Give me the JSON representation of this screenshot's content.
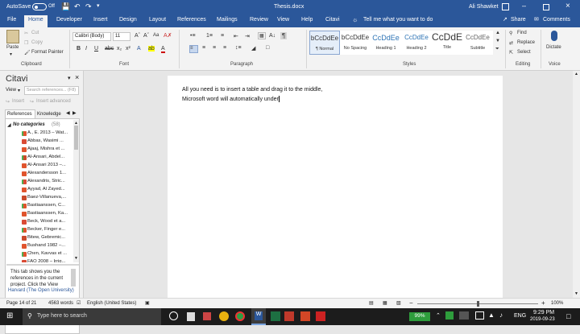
{
  "titlebar": {
    "autosave": "AutoSave",
    "autosave_state": "Off",
    "filename": "Thesis.docx",
    "user": "Ali Shawket"
  },
  "tabs": [
    "File",
    "Home",
    "Developer",
    "Insert",
    "Design",
    "Layout",
    "References",
    "Mailings",
    "Review",
    "View",
    "Help",
    "Citavi"
  ],
  "tell_me": "Tell me what you want to do",
  "share": "Share",
  "comments": "Comments",
  "clipboard": {
    "paste": "Paste",
    "cut": "Cut",
    "copy": "Copy",
    "format_painter": "Format Painter",
    "label": "Clipboard"
  },
  "font": {
    "name": "Calibri (Body)",
    "size": "11",
    "label": "Font"
  },
  "paragraph": {
    "label": "Paragraph"
  },
  "styles": {
    "label": "Styles",
    "items": [
      {
        "preview": "bCcDdEe",
        "name": "¶ Normal"
      },
      {
        "preview": "bCcDdEe",
        "name": "No Spacing"
      },
      {
        "preview": "CcDdEe",
        "name": "Heading 1"
      },
      {
        "preview": "CcDdEe",
        "name": "Heading 2"
      },
      {
        "preview": "CcDdEe",
        "name": "Title"
      },
      {
        "preview": "CcDdEe",
        "name": "Subtitle"
      }
    ]
  },
  "editing": {
    "find": "Find",
    "replace": "Replace",
    "select": "Select",
    "label": "Editing"
  },
  "voice": {
    "dictate": "Dictate",
    "label": "Voice"
  },
  "citavi": {
    "title": "Citavi",
    "view": "View",
    "search_placeholder": "Search references... (F8)",
    "insert": "Insert",
    "insert_advanced": "Insert advanced",
    "tab_references": "References",
    "tab_knowledge": "Knowledge",
    "category": "No categories",
    "category_count": "(58)",
    "refs": [
      "A., E. 2013 – Wat...",
      "Abbas, Wasimi ...",
      "Ajaaj, Mishra et ...",
      "Al-Ansari, Abdel...",
      "Al-Ansari 2013 –...",
      "Alexandersson 1...",
      "Alexandris, Stric...",
      "Ayyad, Al Zayed...",
      "Baez-Villanueva,...",
      "Bastiaanssen, C...",
      "Bastiaanssen, Ka...",
      "Beck, Wood et a...",
      "Becker, Finger e...",
      "Bitew, Gebremic...",
      "Bushand 1982 –...",
      "Chen, Kavvas et ...",
      "FAO 2008 – Irrig..."
    ],
    "info": "This tab shows you the references in the current project. Click the View",
    "footer": "Harvard (The Open University)"
  },
  "document": {
    "line1": "All you need is to insert a table and drag it to the middle,",
    "line2": "Microsoft word will automatically under"
  },
  "status": {
    "page": "Page 14 of 21",
    "words": "4563 words",
    "language": "English (United States)",
    "zoom": "100%"
  },
  "taskbar": {
    "search": "Type here to search",
    "battery": "99%",
    "lang": "ENG",
    "time": "9:29 PM",
    "date": "2019-09-23"
  },
  "colors": {
    "word_blue": "#2b579a",
    "taskbar": "#1c1c1c"
  }
}
